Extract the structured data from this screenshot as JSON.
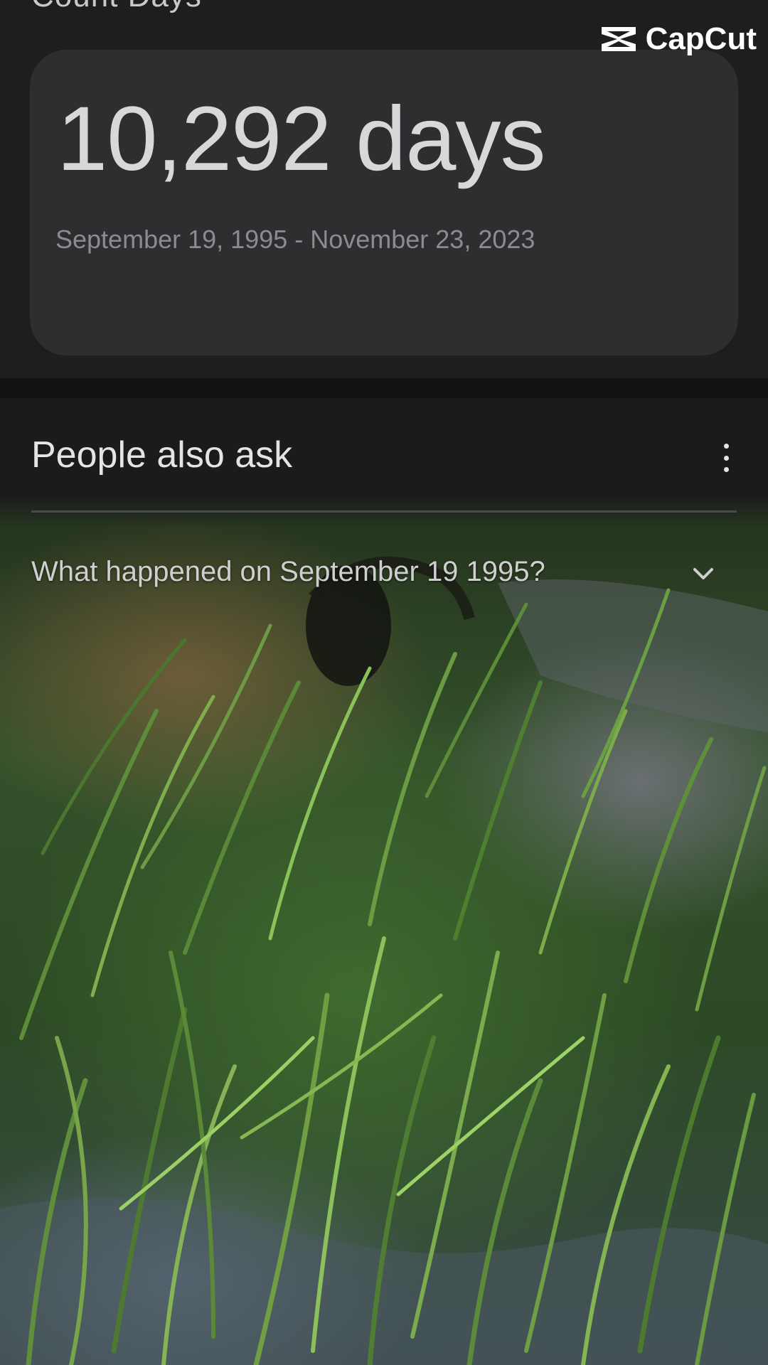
{
  "header": {
    "clipped_title": "Count Days"
  },
  "count_card": {
    "value": "10,292 days",
    "range": "September 19, 1995 - November 23, 2023"
  },
  "people_also_ask": {
    "title": "People also ask",
    "questions": [
      {
        "text": "What happened on September 19 1995?"
      }
    ]
  },
  "watermark": {
    "text": "CapCut"
  },
  "icons": {
    "menu": "more-vert-icon",
    "expand": "chevron-down-icon",
    "logo": "capcut-logo-icon"
  }
}
